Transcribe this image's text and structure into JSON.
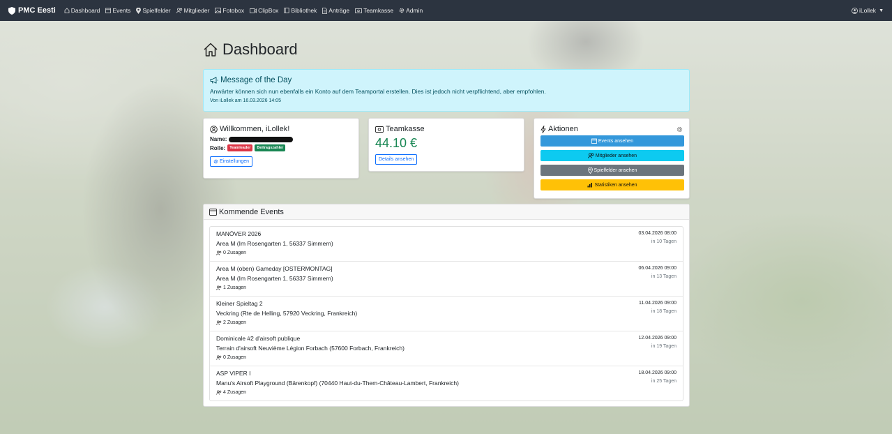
{
  "navbar": {
    "brand": "PMC Eesti",
    "items": [
      {
        "label": "Dashboard",
        "icon": "house-icon"
      },
      {
        "label": "Events",
        "icon": "calendar-icon"
      },
      {
        "label": "Spielfelder",
        "icon": "map-pin-icon"
      },
      {
        "label": "Mitglieder",
        "icon": "people-icon"
      },
      {
        "label": "Fotobox",
        "icon": "image-icon"
      },
      {
        "label": "ClipBox",
        "icon": "video-icon"
      },
      {
        "label": "Bibliothek",
        "icon": "book-icon"
      },
      {
        "label": "Anträge",
        "icon": "document-icon"
      },
      {
        "label": "Teamkasse",
        "icon": "cash-icon"
      },
      {
        "label": "Admin",
        "icon": "gear-icon"
      }
    ],
    "user": "iLollek"
  },
  "page": {
    "title": "Dashboard"
  },
  "motd": {
    "title": "Message of the Day",
    "text": "Anwärter können sich nun ebenfalls ein Konto auf dem Teamportal erstellen. Dies ist jedoch nicht verpflichtend, aber empfohlen.",
    "meta": "Von iLollek am 16.03.2026 14:05"
  },
  "welcome": {
    "title": "Willkommen, iLollek!",
    "name_label": "Name:",
    "role_label": "Rolle:",
    "badges": [
      "Teamleader",
      "Beitragszahler"
    ],
    "settings_label": "Einstellungen"
  },
  "teamkasse": {
    "title": "Teamkasse",
    "amount": "44.10 €",
    "details_label": "Details ansehen"
  },
  "actions": {
    "title": "Aktionen",
    "buttons": [
      {
        "label": "Events ansehen"
      },
      {
        "label": "Mitglieder ansehen"
      },
      {
        "label": "Spielfelder ansehen"
      },
      {
        "label": "Statistiken ansehen"
      }
    ]
  },
  "events": {
    "title": "Kommende Events",
    "items": [
      {
        "name": "MANÖVER 2026",
        "location": "Area M (Im Rosengarten 1, 56337 Simmern)",
        "count": "0 Zusagen",
        "date": "03.04.2026 08:00",
        "relative": "in 10 Tagen"
      },
      {
        "name": "Area M (oben) Gameday [OSTERMONTAG]",
        "location": "Area M (Im Rosengarten 1, 56337 Simmern)",
        "count": "1 Zusagen",
        "date": "06.04.2026 09:00",
        "relative": "in 13 Tagen"
      },
      {
        "name": "Kleiner Spieltag 2",
        "location": "Veckring (Rte de Helling, 57920 Veckring, Frankreich)",
        "count": "2 Zusagen",
        "date": "11.04.2026 09:00",
        "relative": "in 18 Tagen"
      },
      {
        "name": "Dominicale #2 d'airsoft publique",
        "location": "Terrain d'airsoft Neuvième Légion Forbach (57600 Forbach, Frankreich)",
        "count": "0 Zusagen",
        "date": "12.04.2026 09:00",
        "relative": "in 19 Tagen"
      },
      {
        "name": "ASP VIPER I",
        "location": "Manu's Airsoft Playground (Bärenkopf) (70440 Haut-du-Them-Château-Lambert, Frankreich)",
        "count": "4 Zusagen",
        "date": "18.04.2026 09:00",
        "relative": "in 25 Tagen"
      }
    ]
  },
  "colors": {
    "navbar": "#2c3440",
    "motd_bg": "#cff4fc",
    "kasse_amount": "#198754",
    "badge_teamleader": "#dc3545",
    "badge_beitragszahler": "#198754",
    "action_events": "#3498db",
    "action_mitglieder": "#0dcaf0",
    "action_spielfelder": "#6c757d",
    "action_statistiken": "#ffc107"
  }
}
